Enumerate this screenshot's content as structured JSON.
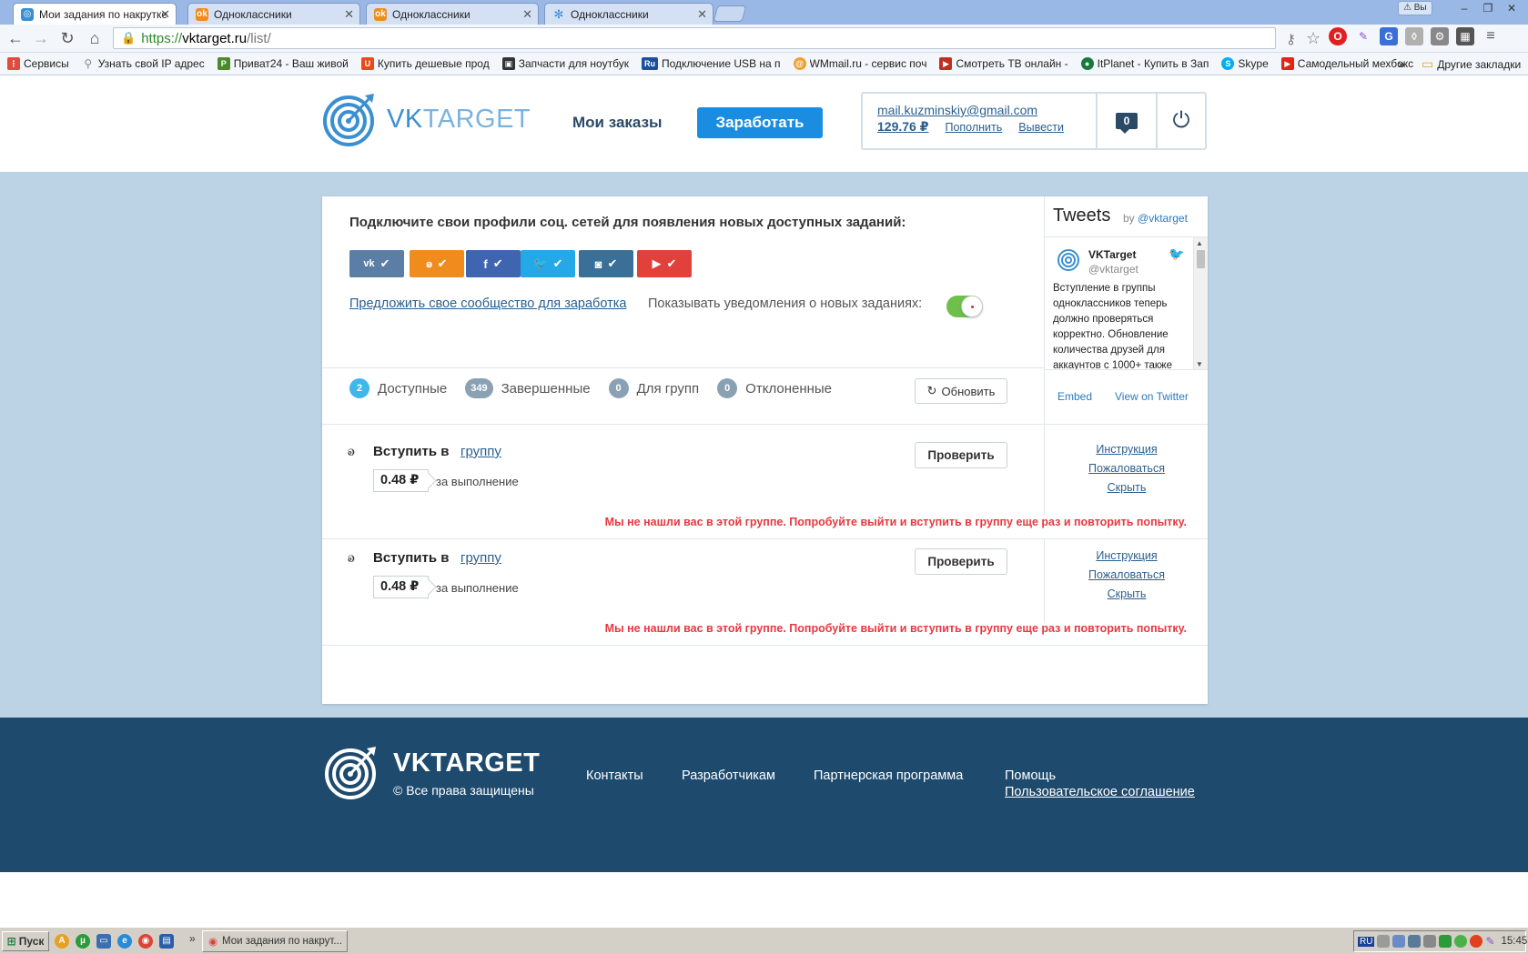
{
  "browser": {
    "tabs": [
      {
        "label": "Мои задания по накрутке",
        "icon": "vktarget-favicon",
        "active": true
      },
      {
        "label": "Одноклассники",
        "icon": "ok-favicon",
        "active": false
      },
      {
        "label": "Одноклассники",
        "icon": "ok-favicon",
        "active": false
      },
      {
        "label": "Одноклассники",
        "icon": "loading-favicon",
        "active": false
      }
    ],
    "tab_close": "✕",
    "alert_label": "Вы",
    "window_controls": [
      "‒",
      "❐",
      "✕"
    ],
    "url": {
      "scheme": "https://",
      "host": "vktarget.ru",
      "path": "/list/"
    },
    "bookmarks": [
      {
        "label": "Сервисы",
        "icon": "apps-icon",
        "color": "#e04b3c"
      },
      {
        "label": "Узнать свой IP адрес",
        "icon": "search-icon",
        "color": "#888888"
      },
      {
        "label": "Приват24 - Ваш живой",
        "icon": "privat-icon",
        "color": "#4a8a2a"
      },
      {
        "label": "Купить дешевые прод",
        "icon": "shop-icon",
        "color": "#e54c1c"
      },
      {
        "label": "Запчасти для ноутбук",
        "icon": "parts-icon",
        "color": "#333333"
      },
      {
        "label": "Подключение USB на п",
        "icon": "ru-icon",
        "color": "#1c4f9c"
      },
      {
        "label": "WMmail.ru - сервис поч",
        "icon": "wmmail-icon",
        "color": "#f0a030"
      },
      {
        "label": "Смотреть ТВ онлайн -",
        "icon": "tv-icon",
        "color": "#c03020"
      },
      {
        "label": "ItPlanet - Купить в Зап",
        "icon": "planet-icon",
        "color": "#1a7a3a"
      },
      {
        "label": "Skype",
        "icon": "skype-icon",
        "color": "#00aff0"
      },
      {
        "label": "Самодельный мехбокс",
        "icon": "youtube-icon",
        "color": "#e62117"
      }
    ],
    "bookmarks_more": "»",
    "other_bookmarks": "Другие закладки"
  },
  "header": {
    "logo_part1": "VK",
    "logo_part2": "TARGET",
    "my_orders": "Мои заказы",
    "earn": "Заработать",
    "email": "mail.kuzminskiy@gmail.com",
    "balance": "129.76 ₽",
    "topup": "Пополнить",
    "withdraw": "Вывести",
    "messages_count": "0",
    "power_icon": "⏻"
  },
  "connect": {
    "title": "Подключите свои профили соц. сетей для появления новых доступных заданий:",
    "networks": [
      {
        "name": "vk",
        "glyph": "vk",
        "color": "#5b7ea7"
      },
      {
        "name": "odnoklassniki",
        "glyph": "ok",
        "color": "#f08c1e"
      },
      {
        "name": "facebook",
        "glyph": "f",
        "color": "#3f65b0"
      },
      {
        "name": "twitter",
        "glyph": "tw",
        "color": "#24a8e8"
      },
      {
        "name": "instagram",
        "glyph": "ig",
        "color": "#3a6f97"
      },
      {
        "name": "youtube",
        "glyph": "yt",
        "color": "#e2403a"
      }
    ],
    "suggest_link": "Предложить свое сообщество для заработка",
    "notif_label": "Показывать уведомления о новых заданиях:",
    "notif_on": true
  },
  "filters": [
    {
      "count": "2",
      "label": "Доступные",
      "active": true
    },
    {
      "count": "349",
      "label": "Завершенные",
      "active": false
    },
    {
      "count": "0",
      "label": "Для групп",
      "active": false
    },
    {
      "count": "0",
      "label": "Отклоненные",
      "active": false
    }
  ],
  "refresh": "Обновить",
  "tasks": [
    {
      "title": "Вступить в",
      "link": "группу",
      "price": "0.48 ₽",
      "price_note": "за выполнение",
      "check": "Проверить",
      "side": [
        "Инструкция",
        "Пожаловаться",
        "Скрыть"
      ],
      "error": "Мы не нашли вас в этой группе. Попробуйте выйти и вступить в группу еще раз и повторить попытку."
    },
    {
      "title": "Вступить в",
      "link": "группу",
      "price": "0.48 ₽",
      "price_note": "за выполнение",
      "check": "Проверить",
      "side": [
        "Инструкция",
        "Пожаловаться",
        "Скрыть"
      ],
      "error": "Мы не нашли вас в этой группе. Попробуйте выйти и вступить в группу еще раз и повторить попытку."
    }
  ],
  "tweets": {
    "title": "Tweets",
    "by": "by",
    "by_handle": "@vktarget",
    "name": "VKTarget",
    "handle": "@vktarget",
    "text": "Вступление в группы одноклассников теперь должно проверяться корректно. Обновление количества друзей для аккаунтов с 1000+ также",
    "embed": "Embed",
    "view": "View on Twitter"
  },
  "footer": {
    "logo": "VKTARGET",
    "copyright": "© Все права защищены",
    "links": [
      "Контакты",
      "Разработчикам",
      "Партнерская программа",
      "Помощь"
    ],
    "terms": "Пользовательское соглашение"
  },
  "taskbar": {
    "start": "Пуск",
    "more": "»",
    "task_label": "Мои задания по накрут...",
    "lang": "RU",
    "clock": "15:45"
  },
  "colors": {
    "accent": "#1a8de0",
    "navy": "#1e4a6e",
    "error": "#e8383f",
    "page_bg": "#bcd3e6"
  }
}
